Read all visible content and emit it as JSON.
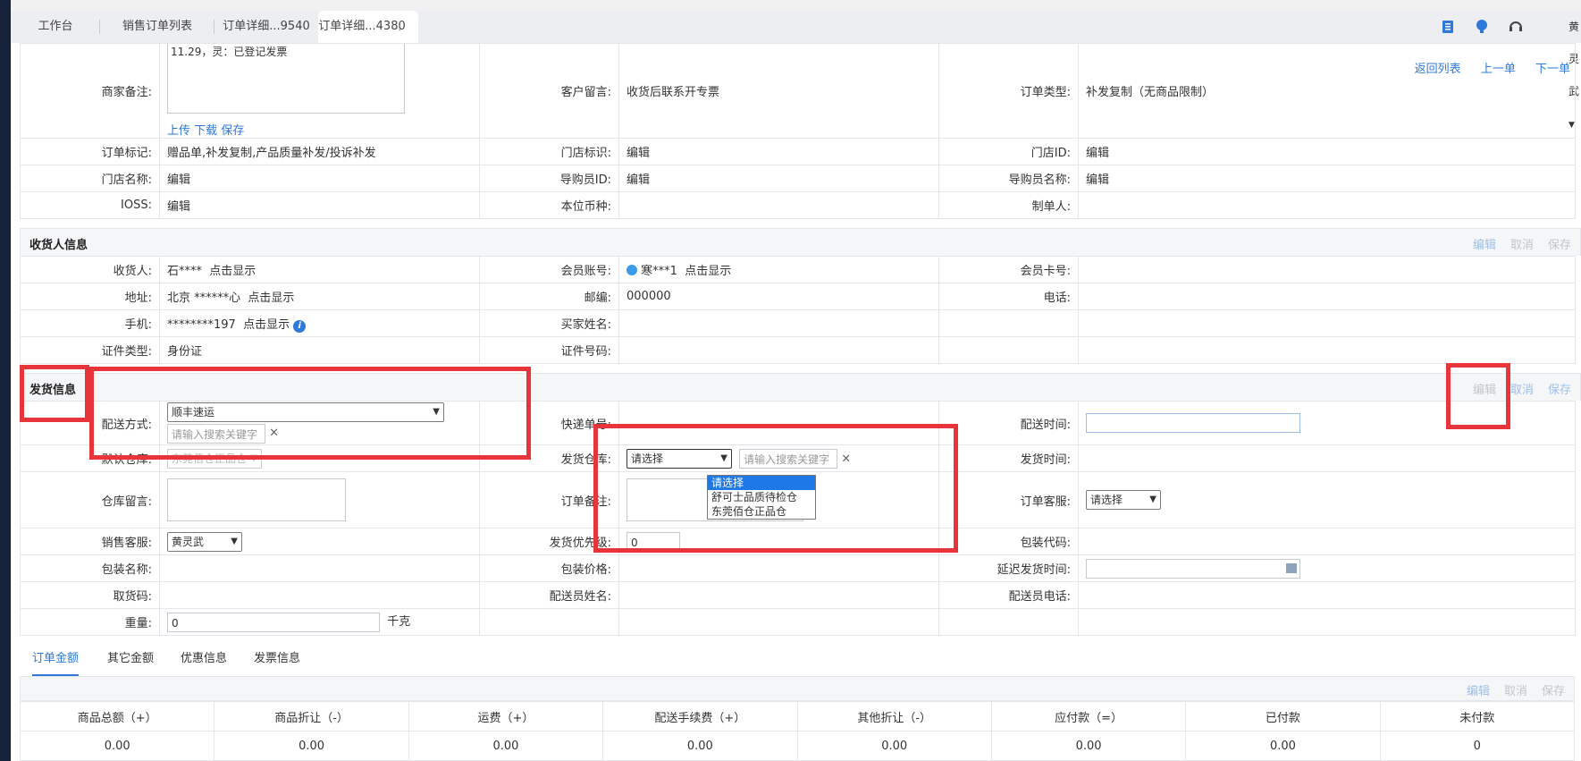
{
  "tabs": [
    {
      "label": "工作台"
    },
    {
      "label": "销售订单列表"
    },
    {
      "label": "订单详细...9540"
    },
    {
      "label": "订单详细...4380"
    }
  ],
  "user": {
    "name": "黄灵武"
  },
  "top_links": {
    "back": "返回列表",
    "prev": "上一单",
    "next": "下一单"
  },
  "order_info": {
    "merchant_note_label": "商家备注:",
    "merchant_note_value": "11.29，灵：已登记发票",
    "note_actions": {
      "upload": "上传",
      "download": "下载",
      "save": "保存"
    },
    "customer_msg_label": "客户留言:",
    "customer_msg_value": "收货后联系开专票",
    "order_type_label": "订单类型:",
    "order_type_value": "补发复制（无商品限制）",
    "order_mark_label": "订单标记:",
    "order_mark_value": "赠品单,补发复制,产品质量补发/投诉补发",
    "store_mark_label": "门店标识:",
    "store_mark_value": "编辑",
    "store_id_label": "门店ID:",
    "store_id_value": "编辑",
    "store_name_label": "门店名称:",
    "store_name_value": "编辑",
    "guide_id_label": "导购员ID:",
    "guide_id_value": "编辑",
    "guide_name_label": "导购员名称:",
    "guide_name_value": "编辑",
    "ioss_label": "IOSS:",
    "ioss_value": "编辑",
    "currency_label": "本位币种:",
    "maker_label": "制单人:"
  },
  "receiver": {
    "title": "收货人信息",
    "actions": {
      "edit": "编辑",
      "cancel": "取消",
      "save": "保存"
    },
    "name_label": "收货人:",
    "name_value": "石****",
    "show": "点击显示",
    "member_label": "会员账号:",
    "member_value": "寒***1",
    "card_label": "会员卡号:",
    "addr_label": "地址:",
    "addr_value": "北京 ******心",
    "zip_label": "邮编:",
    "zip_value": "000000",
    "phone_label": "电话:",
    "mobile_label": "手机:",
    "mobile_value": "********197",
    "buyer_label": "买家姓名:",
    "idtype_label": "证件类型:",
    "idtype_value": "身份证",
    "idno_label": "证件号码:"
  },
  "shipping": {
    "title": "发货信息",
    "actions": {
      "edit": "编辑",
      "cancel": "取消",
      "save": "保存"
    },
    "method_label": "配送方式:",
    "method_value": "顺丰速运",
    "search_placeholder": "请输入搜索关键字",
    "tracking_label": "快递单号:",
    "ship_time_label": "配送时间:",
    "default_wh_label": "默认仓库:",
    "default_wh_value": "东莞佰仓正品仓",
    "send_wh_label": "发货仓库:",
    "send_wh_value": "请选择",
    "send_wh_options": [
      "请选择",
      "舒可士品质待检仓",
      "东莞佰仓正品仓"
    ],
    "send_time_label": "发货时间:",
    "wh_msg_label": "仓库留言:",
    "order_note_label": "订单备注:",
    "order_cs_label": "订单客服:",
    "order_cs_value": "请选择",
    "sales_cs_label": "销售客服:",
    "sales_cs_value": "黄灵武",
    "priority_label": "发货优先级:",
    "priority_value": "0",
    "pack_code_label": "包装代码:",
    "pack_name_label": "包装名称:",
    "pack_price_label": "包装价格:",
    "delay_label": "延迟发货时间:",
    "pickup_label": "取货码:",
    "courier_name_label": "配送员姓名:",
    "courier_phone_label": "配送员电话:",
    "weight_label": "重量:",
    "weight_value": "0",
    "weight_unit": "千克"
  },
  "subtabs": [
    {
      "label": "订单金额"
    },
    {
      "label": "其它金额"
    },
    {
      "label": "优惠信息"
    },
    {
      "label": "发票信息"
    }
  ],
  "amount": {
    "actions": {
      "edit": "编辑",
      "cancel": "取消",
      "save": "保存"
    },
    "headers": [
      "商品总额（+）",
      "商品折让（-）",
      "运费（+）",
      "配送手续费（+）",
      "其他折让（-）",
      "应付款（=）",
      "已付款",
      "未付款"
    ],
    "values": [
      "0.00",
      "0.00",
      "0.00",
      "0.00",
      "0.00",
      "0.00",
      "0.00",
      "0"
    ]
  },
  "colors": {
    "accent": "#2f7ad8",
    "highlight_box": "#e8343b",
    "option_highlight": "#1e78e6"
  }
}
